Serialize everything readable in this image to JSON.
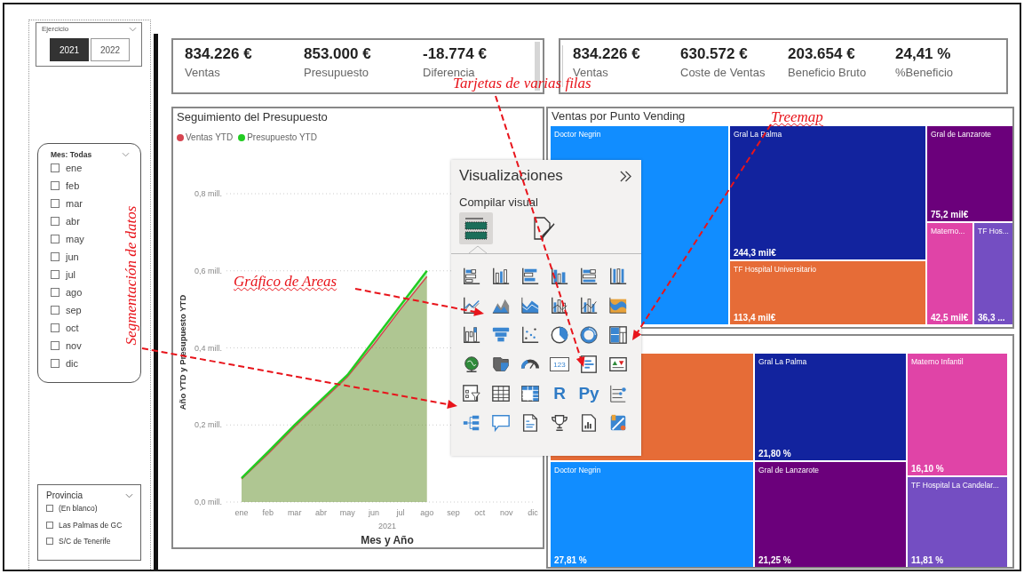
{
  "year_slicer": {
    "title": "Ejercicio",
    "options": [
      {
        "label": "2021",
        "selected": true
      },
      {
        "label": "2022",
        "selected": false
      }
    ]
  },
  "month_slicer": {
    "title": "Mes: Todas",
    "items": [
      {
        "label": "ene",
        "checked": false
      },
      {
        "label": "feb",
        "checked": false
      },
      {
        "label": "mar",
        "checked": false
      },
      {
        "label": "abr",
        "checked": false
      },
      {
        "label": "may",
        "checked": false
      },
      {
        "label": "jun",
        "checked": false
      },
      {
        "label": "jul",
        "checked": false
      },
      {
        "label": "ago",
        "checked": false
      },
      {
        "label": "sep",
        "checked": false
      },
      {
        "label": "oct",
        "checked": false
      },
      {
        "label": "nov",
        "checked": false
      },
      {
        "label": "dic",
        "checked": false
      }
    ]
  },
  "province_slicer": {
    "title": "Provincia",
    "items": [
      {
        "label": "(En blanco)",
        "checked": false
      },
      {
        "label": "Las Palmas de GC",
        "checked": false
      },
      {
        "label": "S/C de Tenerife",
        "checked": false
      }
    ]
  },
  "kpi_cards": [
    {
      "items": [
        {
          "value": "834.226 €",
          "label": "Ventas"
        },
        {
          "value": "853.000 €",
          "label": "Presupuesto"
        },
        {
          "value": "-18.774 €",
          "label": "Diferencia"
        }
      ]
    },
    {
      "items": [
        {
          "value": "834.226 €",
          "label": "Ventas"
        },
        {
          "value": "630.572 €",
          "label": "Coste de Ventas"
        },
        {
          "value": "203.654 €",
          "label": "Beneficio Bruto"
        },
        {
          "value": "24,41 %",
          "label": "%Beneficio"
        }
      ]
    }
  ],
  "budget_chart": {
    "title": "Seguimiento del Presupuesto",
    "x_axis_group": "2021",
    "chart_data": {
      "type": "area",
      "grid": true,
      "xlabel": "Mes y Año",
      "ylabel": "Año YTD y Presupuesto YTD",
      "categories": [
        "ene",
        "feb",
        "mar",
        "abr",
        "may",
        "jun",
        "jul",
        "ago",
        "sep",
        "oct",
        "nov",
        "dic"
      ],
      "series": [
        {
          "name": "Ventas YTD",
          "color": "#d64550",
          "values": [
            0.06,
            0.125,
            0.195,
            0.26,
            0.325,
            0.41,
            0.5,
            0.585,
            null,
            null,
            null,
            null
          ]
        },
        {
          "name": "Presupuesto YTD",
          "color": "#22cc22",
          "values": [
            0.062,
            0.13,
            0.2,
            0.265,
            0.33,
            0.42,
            0.51,
            0.6,
            null,
            null,
            null,
            null
          ]
        }
      ],
      "ylim": [
        0,
        0.8
      ],
      "yticks": [
        {
          "value": 0,
          "label": "0,0 mill."
        },
        {
          "value": 0.2,
          "label": "0,2 mill."
        },
        {
          "value": 0.4,
          "label": "0,4 mill."
        },
        {
          "value": 0.6,
          "label": "0,6 mill."
        },
        {
          "value": 0.8,
          "label": "0,8 mill."
        }
      ]
    }
  },
  "treemaps": [
    {
      "title": "Ventas por Punto Vending",
      "tiles": [
        {
          "label": "Doctor Negrin",
          "color": "#118dff"
        },
        {
          "label": "Gral La Palma",
          "amount": "244,3 mil€",
          "color": "#12239e"
        },
        {
          "label": "TF Hospital Universitario",
          "amount": "113,4 mil€",
          "color": "#e66c37"
        },
        {
          "label": "Gral de Lanzarote",
          "amount": "75,2 mil€",
          "color": "#6b007b"
        },
        {
          "label": "Materno...",
          "amount": "42,5 mil€",
          "color": "#e044a7"
        },
        {
          "label": "TF Hos...",
          "amount": "36,3 ...",
          "color": "#744ec2"
        }
      ]
    },
    {
      "tiles": [
        {
          "color": "#e66c37"
        },
        {
          "label": "Gral La Palma",
          "amount": "21,80 %",
          "color": "#12239e"
        },
        {
          "label": "Materno Infantil",
          "amount": "16,10 %",
          "color": "#e044a7"
        },
        {
          "label": "Doctor Negrin",
          "amount": "27,81 %",
          "color": "#118dff"
        },
        {
          "label": "Gral de Lanzarote",
          "amount": "21,25 %",
          "color": "#6b007b"
        },
        {
          "label": "TF Hospital La Candelar...",
          "amount": "11,81 %",
          "color": "#744ec2"
        }
      ]
    }
  ],
  "visualizations_pane": {
    "title": "Visualizaciones",
    "subtitle": "Compilar visual",
    "tabs": [
      {
        "kind": "build",
        "selected": true
      },
      {
        "kind": "format",
        "selected": false
      }
    ],
    "icons": [
      {
        "kind": "stacked-bar"
      },
      {
        "kind": "stacked-column"
      },
      {
        "kind": "clustered-bar"
      },
      {
        "kind": "clustered-column"
      },
      {
        "kind": "percent-bar"
      },
      {
        "kind": "percent-column"
      },
      {
        "kind": "line"
      },
      {
        "kind": "area"
      },
      {
        "kind": "stacked-area"
      },
      {
        "kind": "line-column"
      },
      {
        "kind": "line-clustered"
      },
      {
        "kind": "ribbon"
      },
      {
        "kind": "waterfall"
      },
      {
        "kind": "funnel"
      },
      {
        "kind": "scatter"
      },
      {
        "kind": "pie"
      },
      {
        "kind": "donut"
      },
      {
        "kind": "treemap"
      },
      {
        "kind": "globe"
      },
      {
        "kind": "filled-map"
      },
      {
        "kind": "gauge"
      },
      {
        "kind": "card",
        "text": "123"
      },
      {
        "kind": "multirow-card"
      },
      {
        "kind": "kpi"
      },
      {
        "kind": "slicer"
      },
      {
        "kind": "table"
      },
      {
        "kind": "matrix"
      },
      {
        "kind": "r",
        "text": "R"
      },
      {
        "kind": "python",
        "text": "Py"
      },
      {
        "kind": "influencers"
      },
      {
        "kind": "decomposition"
      },
      {
        "kind": "speech"
      },
      {
        "kind": "narrative"
      },
      {
        "kind": "trophy"
      },
      {
        "kind": "report"
      },
      {
        "kind": "apps"
      }
    ]
  },
  "annotations": [
    {
      "text": "Tarjetas de varias filas",
      "kind": "horizontal"
    },
    {
      "text": "Treemap",
      "kind": "horizontal"
    },
    {
      "text": "Gráfico de Areas",
      "kind": "horizontal"
    },
    {
      "text": "Segmentación de datos",
      "kind": "vertical"
    }
  ]
}
